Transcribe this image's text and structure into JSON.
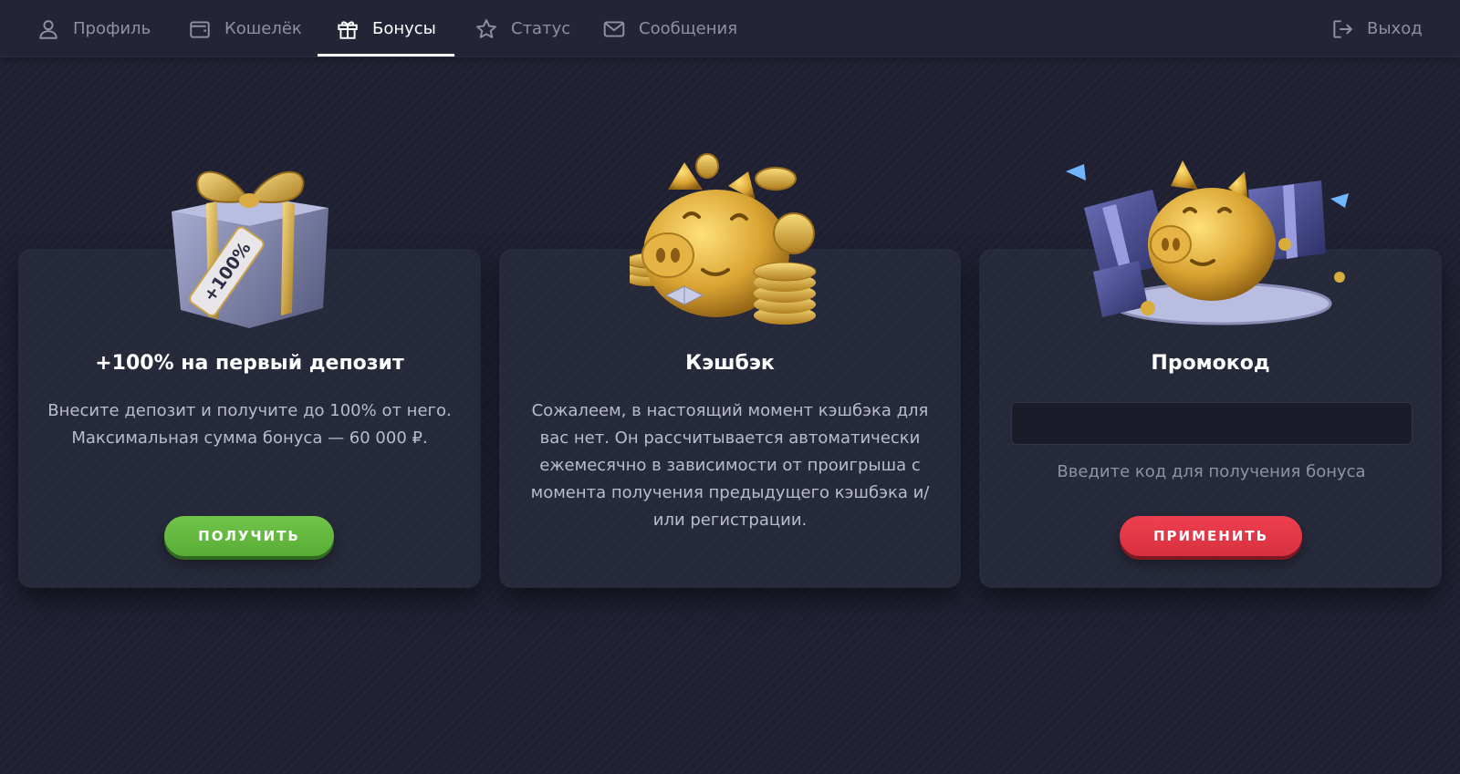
{
  "nav": {
    "items": [
      {
        "label": "Профиль",
        "icon": "user-icon"
      },
      {
        "label": "Кошелёк",
        "icon": "wallet-icon"
      },
      {
        "label": "Бонусы",
        "icon": "gift-icon"
      },
      {
        "label": "Статус",
        "icon": "star-icon"
      },
      {
        "label": "Сообщения",
        "icon": "envelope-icon"
      }
    ],
    "active_item": "Бонусы",
    "logout": {
      "label": "Выход",
      "icon": "logout-icon"
    }
  },
  "cards": {
    "deposit": {
      "title": "+100% на первый депозит",
      "desc_line1": "Внесите депозит и получите до 100% от него.",
      "desc_line2": "Максимальная сумма бонуса — 60 000 ₽.",
      "button": "ПОЛУЧИТЬ",
      "art_icon": "gift-box-icon",
      "tag_text": "+100%"
    },
    "cashback": {
      "title": "Кэшбэк",
      "desc": "Сожалеем, в настоящий момент кэшбэка для вас нет. Он рассчитывается автоматически ежемесячно в зависимости от проигрыша с момента получения предыдущего кэшбэка и/или регистрации.",
      "art_icon": "piggy-bank-coins-icon"
    },
    "promo": {
      "title": "Промокод",
      "input_value": "",
      "hint": "Введите код для получения бонуса",
      "button": "ПРИМЕНИТЬ",
      "art_icon": "piggy-bank-gifts-icon"
    }
  },
  "colors": {
    "background": "#1f2133",
    "card": "#262939",
    "accent_green": "#63b73e",
    "accent_red": "#e6384a",
    "gold": "#d9ad3a"
  }
}
